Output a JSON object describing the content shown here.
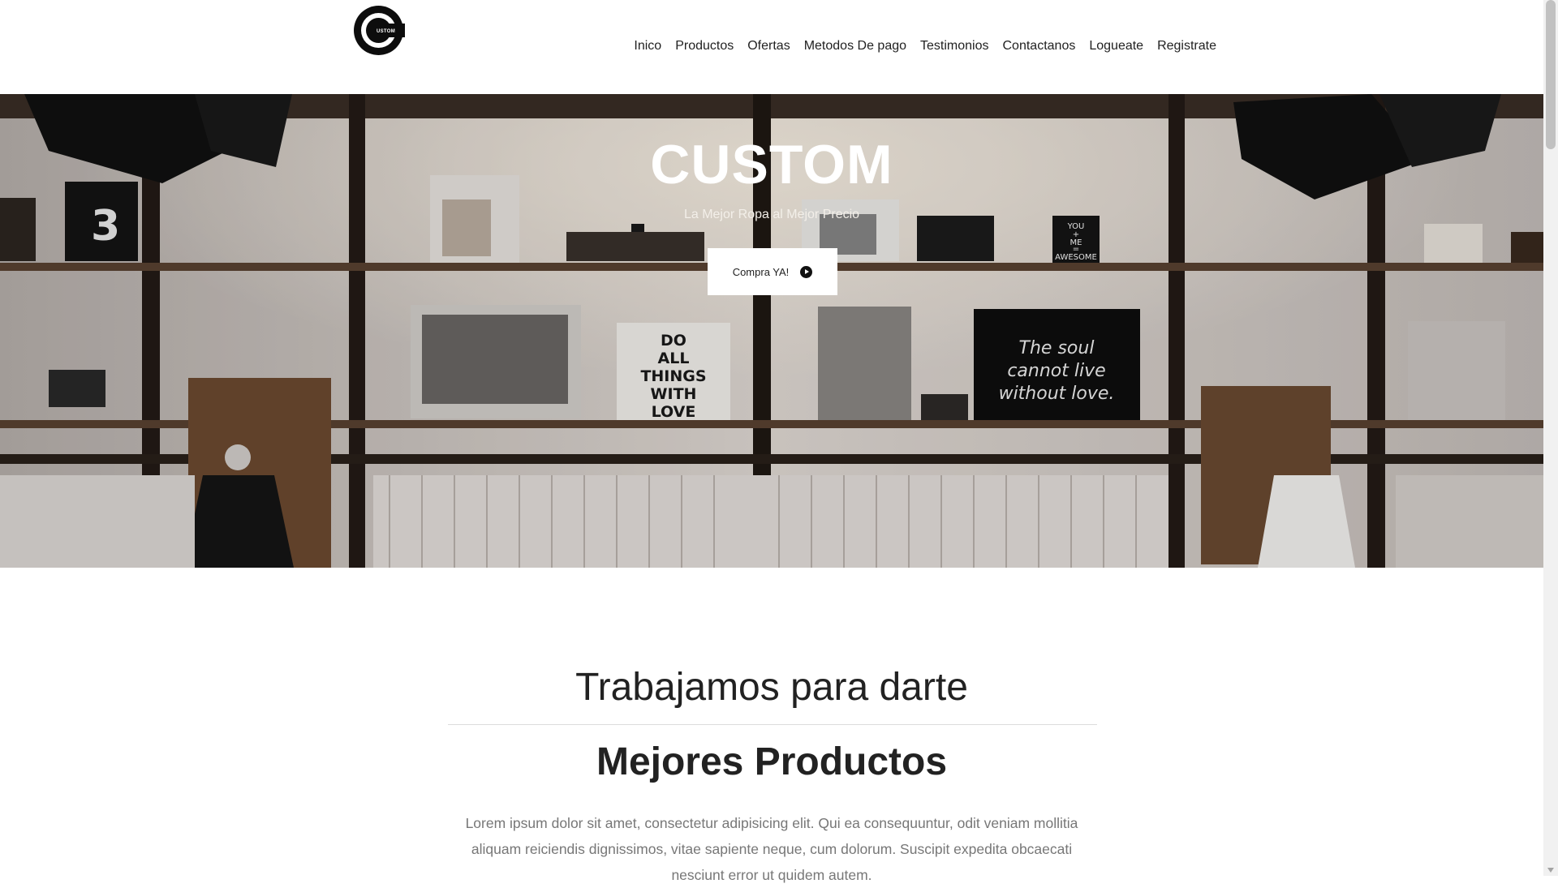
{
  "brand": {
    "logo_text": "USTOM"
  },
  "nav": {
    "items": [
      "Inico",
      "Productos",
      "Ofertas",
      "Metodos De pago",
      "Testimonios",
      "Contactanos",
      "Logueate",
      "Registrate"
    ]
  },
  "hero": {
    "title": "CUSTOM",
    "subtitle": "La Mejor Ropa al Mejor Precio",
    "cta_label": "Compra YA!",
    "signs": {
      "dont": [
        "DO",
        "ALL",
        "THINGS",
        "WITH",
        "LOVE"
      ],
      "soul": [
        "The soul",
        "cannot live",
        "without love."
      ],
      "awesome": [
        "YOU",
        "+",
        "ME",
        "=",
        "AWESOME"
      ],
      "number": "3"
    }
  },
  "section": {
    "heading": "Trabajamos para darte",
    "subheading": "Mejores Productos",
    "paragraph": "Lorem ipsum dolor sit amet, consectetur adipisicing elit. Qui ea consequuntur, odit veniam mollitia aliquam reiciendis dignissimos, vitae sapiente neque, cum dolorum. Suscipit expedita obcaecati nesciunt error ut quidem autem."
  },
  "colors": {
    "accent": "#0d0d0d",
    "text": "#222222",
    "muted": "#777777"
  }
}
